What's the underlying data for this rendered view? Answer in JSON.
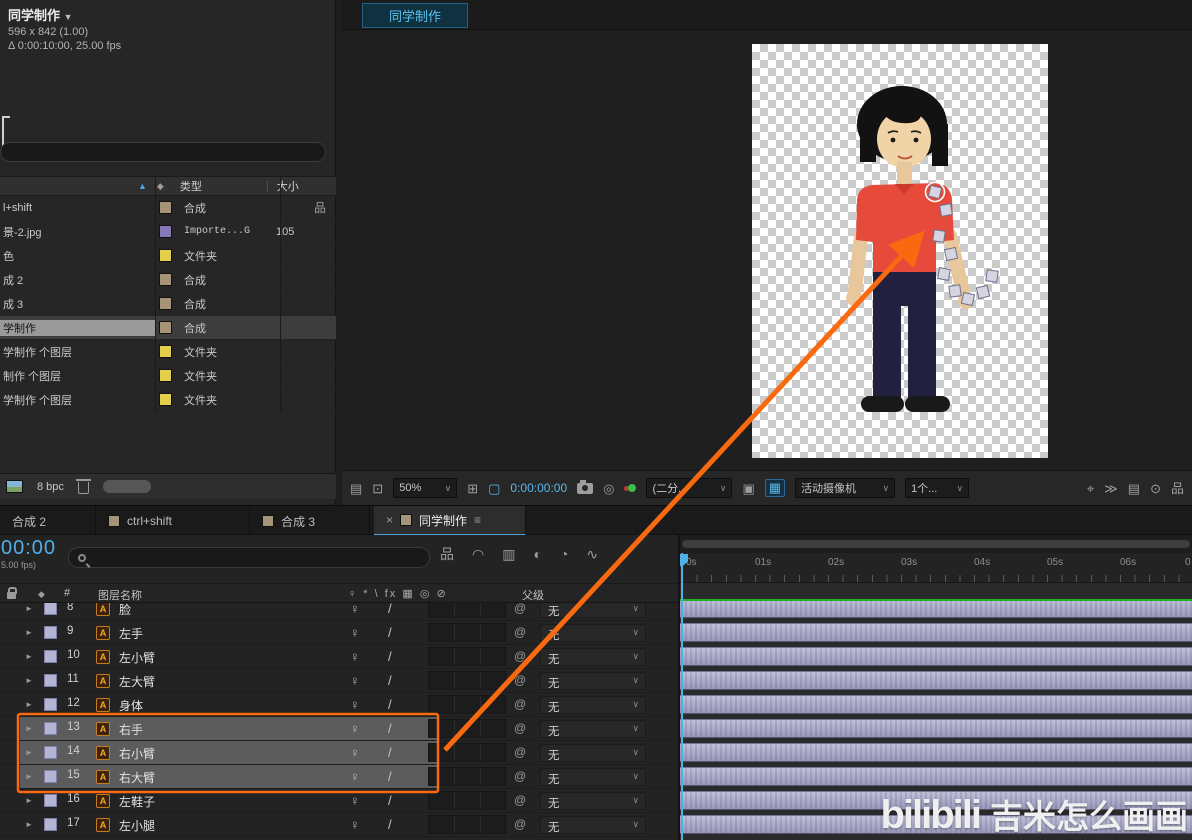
{
  "project": {
    "comp_name": "同学制作",
    "comp_dims": "596 x 842 (1.00)",
    "comp_meta": "Δ 0:00:10:00, 25.00 fps",
    "col_type": "类型",
    "col_size": "大小",
    "items": [
      {
        "name": "l+shift",
        "type": "合成",
        "size": "",
        "kind": "comp"
      },
      {
        "name": "景-2.jpg",
        "type": "Importe...G",
        "size": "105",
        "kind": "footage"
      },
      {
        "name": "色",
        "type": "文件夹",
        "size": "",
        "kind": "folder"
      },
      {
        "name": "成 2",
        "type": "合成",
        "size": "",
        "kind": "comp"
      },
      {
        "name": "成 3",
        "type": "合成",
        "size": "",
        "kind": "comp"
      },
      {
        "name": "学制作",
        "type": "合成",
        "size": "",
        "kind": "comp"
      },
      {
        "name": "学制作 个图层",
        "type": "文件夹",
        "size": "",
        "kind": "folder"
      },
      {
        "name": "制作 个图层",
        "type": "文件夹",
        "size": "",
        "kind": "folder"
      },
      {
        "name": "学制作 个图层",
        "type": "文件夹",
        "size": "",
        "kind": "folder"
      }
    ],
    "bpc": "8 bpc"
  },
  "viewer": {
    "tab": "同学制作",
    "zoom": "50%",
    "timecode": "0:00:00:00",
    "resolution": "(二分...",
    "camera": "活动摄像机",
    "view_layout": "1个..."
  },
  "tabs": {
    "t1": "合成 2",
    "t2": "ctrl+shift",
    "t3": "合成 3",
    "t4": "同学制作"
  },
  "timeline": {
    "timecode": "00:00",
    "fps": "5.00 fps)",
    "col_hash": "#",
    "col_name": "图层名称",
    "col_parent": "父级",
    "switches_header": "♀ * \\ fx ▦ ◎ ⊘",
    "parent_value": "无",
    "ruler": [
      "0s",
      "01s",
      "02s",
      "03s",
      "04s",
      "05s",
      "06s",
      "0"
    ],
    "layers": [
      {
        "num": "8",
        "name": "脸"
      },
      {
        "num": "9",
        "name": "左手"
      },
      {
        "num": "10",
        "name": "左小臂"
      },
      {
        "num": "11",
        "name": "左大臂"
      },
      {
        "num": "12",
        "name": "身体"
      },
      {
        "num": "13",
        "name": "右手"
      },
      {
        "num": "14",
        "name": "右小臂"
      },
      {
        "num": "15",
        "name": "右大臂"
      },
      {
        "num": "16",
        "name": "左鞋子"
      },
      {
        "num": "17",
        "name": "左小腿"
      }
    ]
  },
  "watermark": {
    "logo": "bilibili",
    "text": "吉米怎么画画"
  },
  "icons": {
    "caret_down": "▼",
    "caret_small": "∨",
    "expand": "►",
    "sort": "▲",
    "label": "◆",
    "flowchart": "品",
    "close": "×",
    "menu": "≡",
    "pickwhip": "@",
    "quality": "/",
    "collapse": "♀",
    "grid": "⊞",
    "safe": "▢",
    "roi": "▣",
    "tgrid": "▦",
    "snapshot": "◎",
    "monitor": "⊡",
    "preview": "▤",
    "ai": "A",
    "mini_flowchart": "品",
    "shy": "◠",
    "frame_blend": "▥",
    "motion_blur": "◐",
    "auto_kf": "◔",
    "graph": "∿",
    "fast_prev": "≫",
    "tl_view": "▤",
    "reset_exp": "⊙",
    "exposure": "±",
    "target": "⌖"
  },
  "colors": {
    "accent_blue": "#4ba3d9",
    "annotation_orange": "#f96a10",
    "layer_lavender": "#b4b4d4",
    "folder_yellow": "#e3cf4c",
    "comp_brown": "#a5937a",
    "green_dot": "#37c04a"
  }
}
